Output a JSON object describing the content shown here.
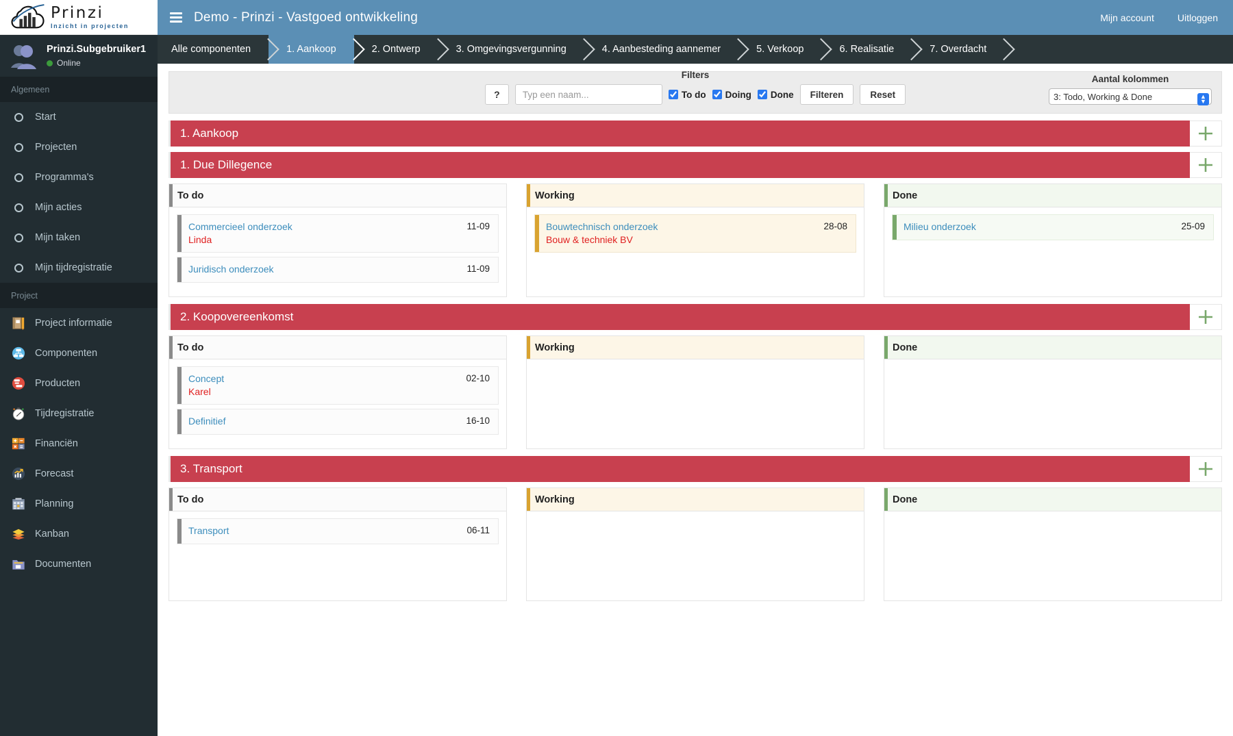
{
  "brand": {
    "title": "Prinzi",
    "subtitle": "Inzicht in projecten",
    "logo_icon": "cloud-chart-logo"
  },
  "user": {
    "name": "Prinzi.Subgebruiker1",
    "status": "Online",
    "avatar_icon": "users-avatar"
  },
  "sidebar": {
    "sections": [
      {
        "header": "Algemeen",
        "items": [
          {
            "label": "Start",
            "icon": "circle-icon"
          },
          {
            "label": "Projecten",
            "icon": "circle-icon"
          },
          {
            "label": "Programma's",
            "icon": "circle-icon"
          },
          {
            "label": "Mijn acties",
            "icon": "circle-icon"
          },
          {
            "label": "Mijn taken",
            "icon": "circle-icon"
          },
          {
            "label": "Mijn tijdregistratie",
            "icon": "circle-icon"
          }
        ]
      },
      {
        "header": "Project",
        "items": [
          {
            "label": "Project informatie",
            "icon": "notebook-pencil-icon"
          },
          {
            "label": "Componenten",
            "icon": "blue-network-icon"
          },
          {
            "label": "Producten",
            "icon": "red-hierarchy-icon"
          },
          {
            "label": "Tijdregistratie",
            "icon": "stopwatch-icon"
          },
          {
            "label": "Financiën",
            "icon": "calculator-icon"
          },
          {
            "label": "Forecast",
            "icon": "chart-trend-icon"
          },
          {
            "label": "Planning",
            "icon": "calendar-icon"
          },
          {
            "label": "Kanban",
            "icon": "layers-icon"
          },
          {
            "label": "Documenten",
            "icon": "folder-icon"
          }
        ]
      }
    ]
  },
  "topbar": {
    "menu_icon": "hamburger-icon",
    "title": "Demo - Prinzi - Vastgoed ontwikkeling",
    "account_label": "Mijn account",
    "logout_label": "Uitloggen"
  },
  "breadcrumb": {
    "items": [
      {
        "label": "Alle componenten",
        "active": false
      },
      {
        "label": "1. Aankoop",
        "active": true
      },
      {
        "label": "2. Ontwerp",
        "active": false
      },
      {
        "label": "3. Omgevingsvergunning",
        "active": false
      },
      {
        "label": "4. Aanbesteding aannemer",
        "active": false
      },
      {
        "label": "5. Verkoop",
        "active": false
      },
      {
        "label": "6. Realisatie",
        "active": false
      },
      {
        "label": "7. Overdacht",
        "active": false
      }
    ]
  },
  "filterbar": {
    "filters_label": "Filters",
    "help_label": "?",
    "search_placeholder": "Typ een naam...",
    "search_value": "",
    "checkboxes": [
      {
        "label": "To do",
        "checked": true
      },
      {
        "label": "Doing",
        "checked": true
      },
      {
        "label": "Done",
        "checked": true
      }
    ],
    "filter_button": "Filteren",
    "reset_button": "Reset",
    "columns_label": "Aantal kolommen",
    "columns_value": "3: Todo, Working & Done",
    "columns_options": [
      "3: Todo, Working & Done"
    ]
  },
  "board": {
    "phase": {
      "title": "1. Aankoop",
      "add_icon": "plus-icon"
    },
    "column_titles": {
      "todo": "To do",
      "working": "Working",
      "done": "Done"
    },
    "groups": [
      {
        "title": "1. Due Dillegence",
        "add_icon": "plus-icon",
        "todo": [
          {
            "title": "Commercieel onderzoek",
            "person": "Linda",
            "date": "11-09"
          },
          {
            "title": "Juridisch onderzoek",
            "person": "",
            "date": "11-09"
          }
        ],
        "working": [
          {
            "title": "Bouwtechnisch onderzoek",
            "person": "Bouw & techniek BV",
            "date": "28-08"
          }
        ],
        "done": [
          {
            "title": "Milieu onderzoek",
            "person": "",
            "date": "25-09"
          }
        ]
      },
      {
        "title": "2. Koopovereenkomst",
        "add_icon": "plus-icon",
        "todo": [
          {
            "title": "Concept",
            "person": "Karel",
            "date": "02-10"
          },
          {
            "title": "Definitief",
            "person": "",
            "date": "16-10"
          }
        ],
        "working": [],
        "done": []
      },
      {
        "title": "3. Transport",
        "add_icon": "plus-icon",
        "todo": [
          {
            "title": "Transport",
            "person": "",
            "date": "06-11"
          }
        ],
        "working": [],
        "done": []
      }
    ]
  },
  "colors": {
    "topbar": "#5b8fb5",
    "crumbbar": "#2b3639",
    "sidebar": "#222d32",
    "phase_bar": "#c8404f",
    "card_link": "#3c8dbc",
    "card_person": "#e02020",
    "working_bg": "#fdf6e7",
    "done_bg": "#f2f8ef",
    "plus_green": "#79a86b"
  }
}
